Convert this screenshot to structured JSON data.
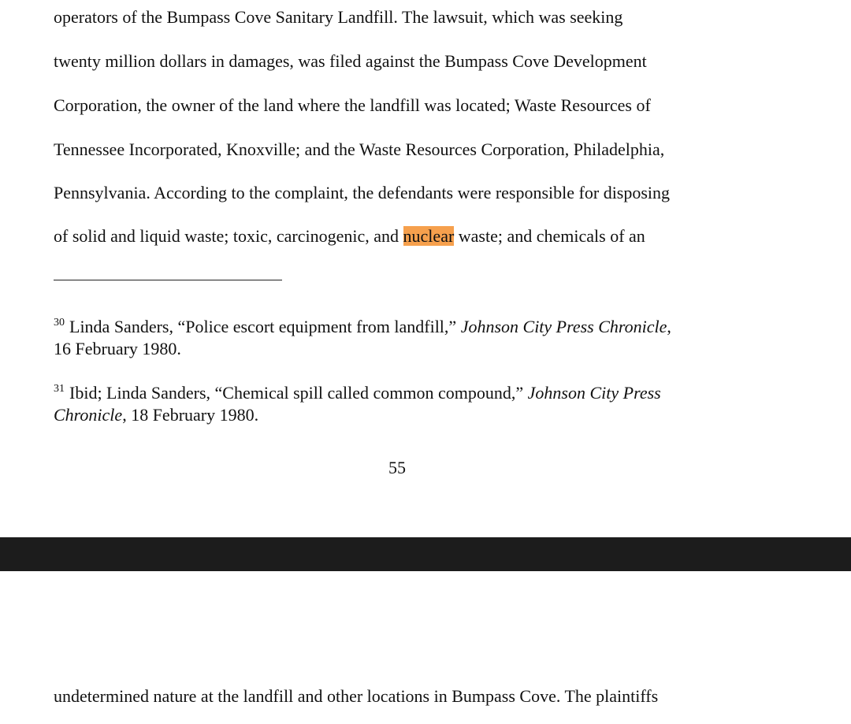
{
  "page_55": {
    "body_lines": [
      "operators of the Bumpass Cove Sanitary Landfill.  The lawsuit, which was seeking",
      "twenty million dollars in damages, was filed against the Bumpass Cove Development",
      "Corporation, the owner of the land where the landfill was located; Waste Resources of",
      "Tennessee Incorporated, Knoxville; and the Waste Resources Corporation, Philadelphia,",
      "Pennsylvania.  According to the complaint, the defendants were responsible for disposing"
    ],
    "last_line": {
      "before": "of solid and liquid waste; toxic, carcinogenic, and ",
      "highlighted": "nuclear",
      "after": " waste; and chemicals of an"
    },
    "footnotes": [
      {
        "number": "30",
        "line1_text": "Linda Sanders, “Police escort equipment from landfill,” ",
        "line1_italic": "Johnson City Press Chronicle",
        "line1_end": ",",
        "line2_italic": "",
        "line2_text": "16 February 1980."
      },
      {
        "number": "31",
        "line1_text": "Ibid; Linda Sanders, “Chemical spill called common compound,” ",
        "line1_italic": "Johnson City Press",
        "line1_end": "",
        "line2_italic": "Chronicle",
        "line2_text": ", 18 February 1980."
      }
    ],
    "page_number": "55"
  },
  "page_56": {
    "first_line": "undetermined nature at the landfill and other locations in Bumpass Cove.  The plaintiffs"
  },
  "colors": {
    "search_highlight": "#f6a04d",
    "page_gap": "#1c1c1c"
  }
}
